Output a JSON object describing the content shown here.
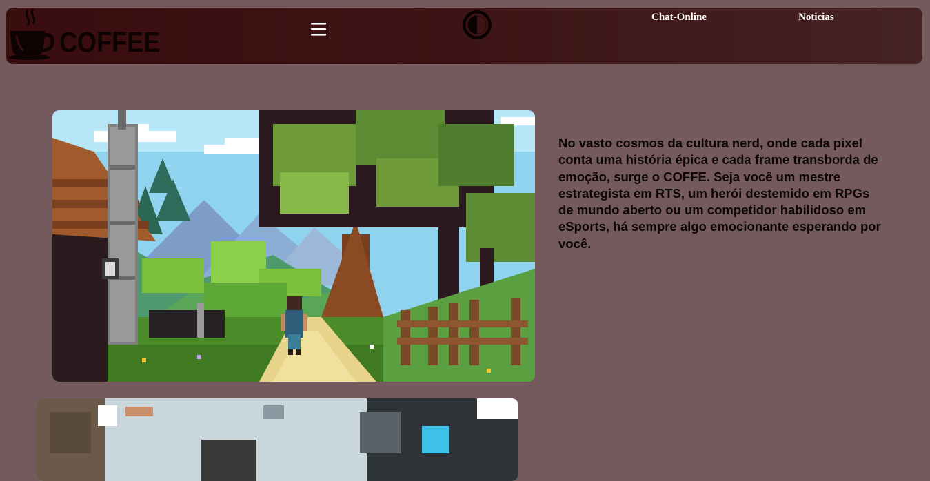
{
  "header": {
    "logo": {
      "text": "COFFEE",
      "icon": "coffee-cup-icon"
    },
    "menu_icon": "hamburger-menu-icon",
    "menu_glyph": "☰",
    "theme_toggle_icon": "contrast-toggle-icon",
    "nav": [
      {
        "label": "Chat-Online"
      },
      {
        "label": "Noticias"
      }
    ]
  },
  "main": {
    "hero_image_alt": "pixel-art-forest-village-scene",
    "intro_text": "No vasto cosmos da cultura nerd, onde cada pixel conta uma história épica e cada frame transborda de emoção, surge o COFFE. Seja você um mestre estrategista em RTS, um herói destemido em RPGs de mundo aberto ou um competidor habilidoso em eSports, há sempre algo emocionante esperando por você.",
    "second_image_alt": "pixel-art-second-scene"
  },
  "colors": {
    "page_background": "#745a5c",
    "navbar_start": "#3a0d0f",
    "navbar_end": "#452223",
    "text_dark": "#0c0606",
    "nav_link": "#ffffff"
  }
}
